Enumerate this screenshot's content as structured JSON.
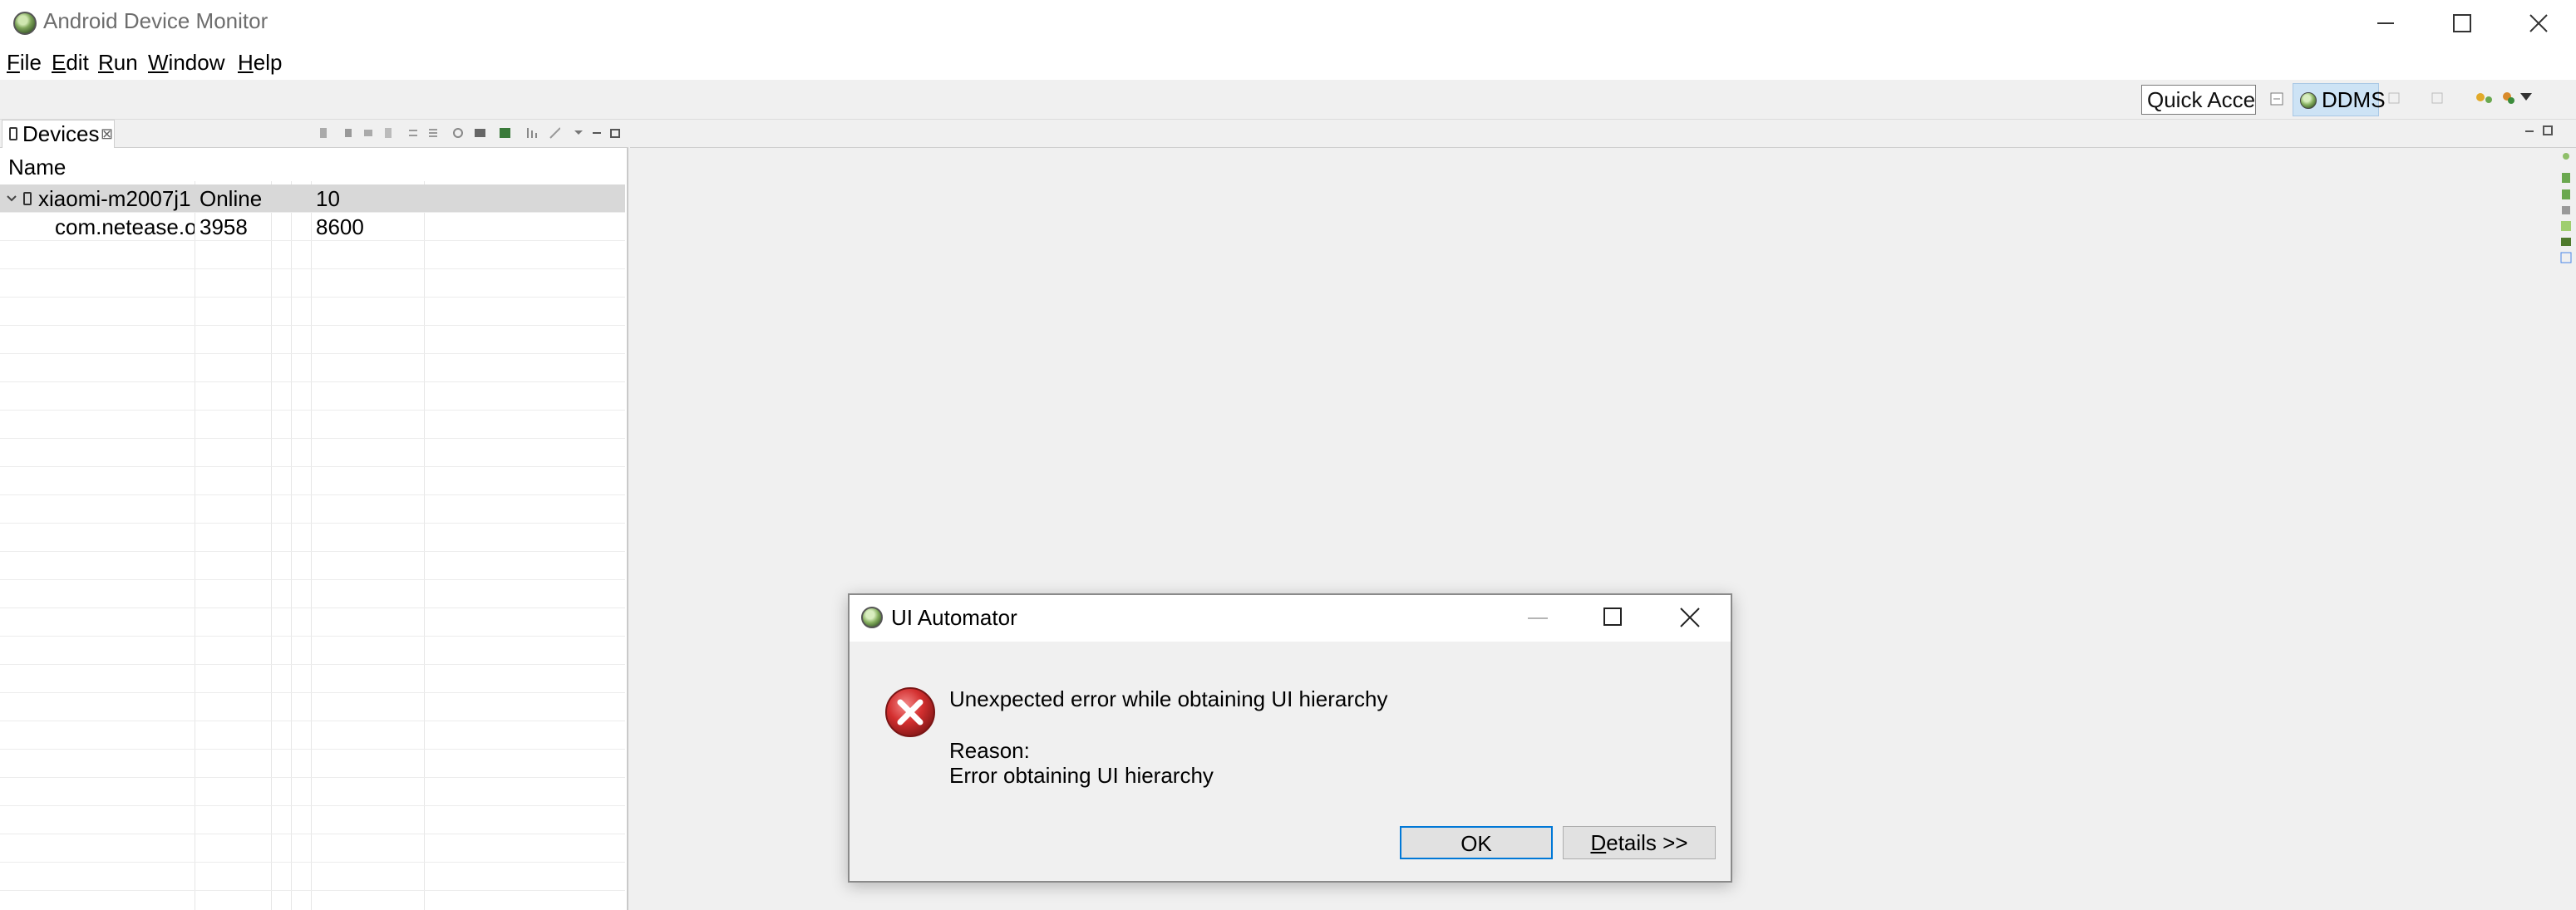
{
  "window": {
    "title": "Android Device Monitor"
  },
  "menu": {
    "items": [
      {
        "mnemonic": "F",
        "rest": "ile"
      },
      {
        "mnemonic": "E",
        "rest": "dit"
      },
      {
        "mnemonic": "R",
        "rest": "un"
      },
      {
        "mnemonic": "W",
        "rest": "indow"
      },
      {
        "mnemonic": "H",
        "rest": "elp"
      }
    ]
  },
  "toolbar": {
    "quick_access": "Quick Acce",
    "perspective": "DDMS"
  },
  "devices": {
    "tab_label": "Devices",
    "tab_close": "⊠",
    "column_name": "Name",
    "rows": [
      {
        "name": "xiaomi-m2007j1",
        "status": "Online",
        "value": "10"
      },
      {
        "name": "com.netease.o",
        "pid": "3958",
        "port": "8600"
      }
    ]
  },
  "dialog": {
    "title": "UI Automator",
    "message": "Unexpected error while obtaining UI hierarchy",
    "reason_label": "Reason:",
    "reason": "Error obtaining UI hierarchy",
    "ok": "OK",
    "details_mnemonic": "D",
    "details_rest": "etails >>"
  },
  "colors": {
    "selection": "#cde3f5",
    "focus_border": "#0078d7",
    "error_red": "#c1272d"
  }
}
